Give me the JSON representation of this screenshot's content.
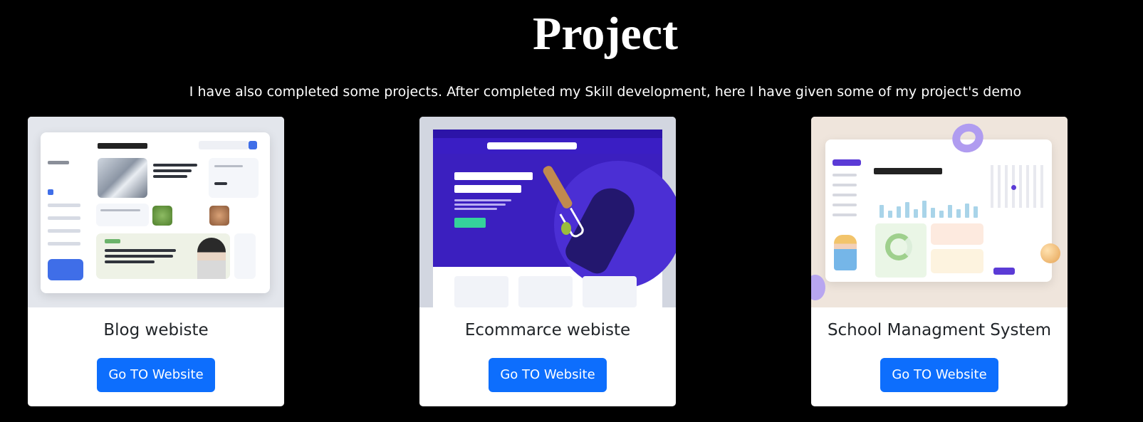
{
  "section": {
    "title": "Project",
    "subtitle": "I have also completed some projects. After completed my Skill development, here I have given some of my project's demo"
  },
  "projects": [
    {
      "title": "Blog webiste",
      "button_label": "Go TO Website"
    },
    {
      "title": "Ecommarce webiste",
      "button_label": "Go TO Website"
    },
    {
      "title": "School Managment System",
      "button_label": "Go TO Website"
    }
  ],
  "colors": {
    "background": "#000000",
    "card": "#ffffff",
    "button": "#0d6efd",
    "card_text": "#212529"
  }
}
